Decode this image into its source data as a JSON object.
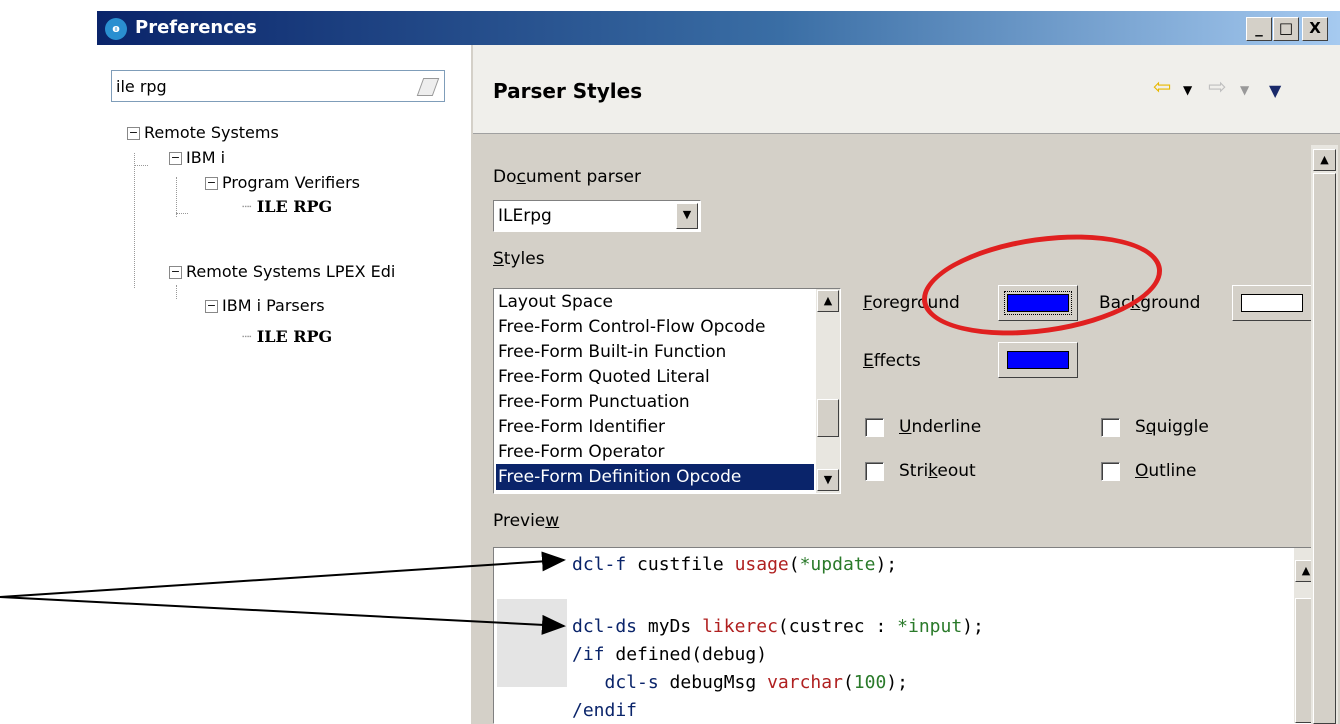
{
  "window": {
    "title": "Preferences",
    "app_icon": "eclipse-icon",
    "controls": [
      "_",
      "□",
      "X"
    ]
  },
  "filter": {
    "value": "ile rpg"
  },
  "tree": {
    "items": [
      {
        "label": "Remote Systems",
        "expander": "−"
      },
      {
        "label": "IBM i",
        "expander": "−"
      },
      {
        "label": "Program Verifiers",
        "expander": "−"
      },
      {
        "label": "ILE RPG"
      },
      {
        "label": "Remote Systems LPEX Edi",
        "expander": "−"
      },
      {
        "label": "IBM i Parsers",
        "expander": "−"
      },
      {
        "label": "ILE RPG"
      }
    ]
  },
  "page": {
    "title": "Parser Styles"
  },
  "document_parser": {
    "label_pre": "Do",
    "label_ul": "c",
    "label_post": "ument parser",
    "value": "ILErpg"
  },
  "styles": {
    "label_ul": "S",
    "label_post": "tyles",
    "items": [
      "Layout Space",
      "Free-Form Control-Flow Opcode",
      "Free-Form Built-in Function",
      "Free-Form Quoted Literal",
      "Free-Form Punctuation",
      "Free-Form Identifier",
      "Free-Form Operator",
      "Free-Form Definition Opcode"
    ],
    "selected": "Free-Form Definition Opcode"
  },
  "foreground": {
    "label_ul": "F",
    "label_post": "oreground",
    "color": "#0000ff"
  },
  "background": {
    "label_pre": "Bac",
    "label_ul": "k",
    "label_post": "ground",
    "color": "#ffffff"
  },
  "effects": {
    "label_ul": "E",
    "label_post": "ffects",
    "color": "#0000ff"
  },
  "checkboxes": {
    "underline": {
      "label_ul": "U",
      "label_post": "nderline"
    },
    "squiggle": {
      "label_pre": "S",
      "label_ul": "q",
      "label_post": "uiggle"
    },
    "strikeout": {
      "label_pre": "Stri",
      "label_ul": "k",
      "label_post": "eout"
    },
    "outline": {
      "label_ul": "O",
      "label_post": "utline"
    }
  },
  "preview": {
    "label_pre": "Previe",
    "label_ul": "w",
    "lines": [
      {
        "a": "dcl-f",
        "b": " custfile ",
        "c": "usage",
        "d": "(",
        "e": "*update",
        "f": ");"
      },
      {
        "a": "dcl-ds",
        "b": " myDs ",
        "c": "likerec",
        "d": "(custrec : ",
        "e": "*input",
        "f": ");"
      },
      {
        "a": "/if",
        "b": " defined(debug)",
        "c": "",
        "d": "",
        "e": "",
        "f": ""
      },
      {
        "a": "   dcl-s",
        "b": " debugMsg ",
        "c": "varchar",
        "d": "(",
        "e": "100",
        "f": ");"
      },
      {
        "a": "/endif",
        "b": "",
        "c": "",
        "d": "",
        "e": "",
        "f": ""
      }
    ]
  },
  "colors": {
    "highlight_ellipse": "#e02020",
    "selection": "#0a246a",
    "keyword": "#0a246a",
    "literal": "#2a7a2a",
    "function": "#b02020"
  }
}
